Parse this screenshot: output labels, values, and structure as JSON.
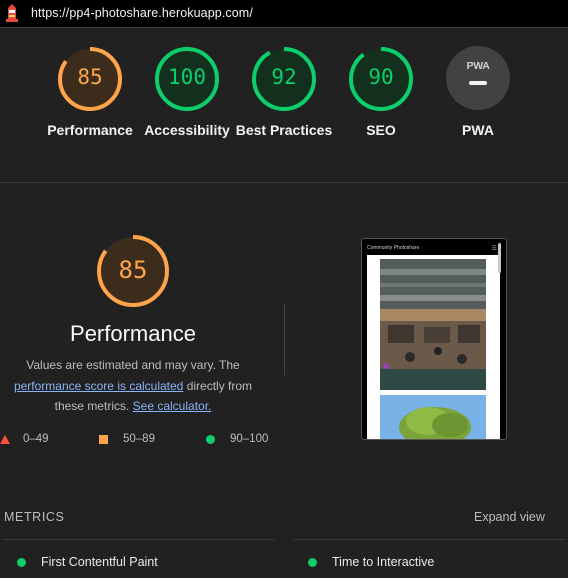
{
  "browser": {
    "url": "https://pp4-photoshare.herokuapp.com/",
    "logo": "lighthouse-icon"
  },
  "colors": {
    "pass": "#0cce6b",
    "average": "#ffa44b",
    "fail": "#ff4e42",
    "link": "#8ab4f8"
  },
  "scores": [
    {
      "label": "Performance",
      "value": "85",
      "score": 85,
      "status": "average"
    },
    {
      "label": "Accessibility",
      "value": "100",
      "score": 100,
      "status": "pass"
    },
    {
      "label": "Best Practices",
      "value": "92",
      "score": 92,
      "status": "pass"
    },
    {
      "label": "SEO",
      "value": "90",
      "score": 90,
      "status": "pass"
    },
    {
      "label": "PWA",
      "badge": "PWA"
    }
  ],
  "performance": {
    "score": "85",
    "score_value": 85,
    "title": "Performance",
    "desc_1": "Values are estimated and may vary. The",
    "link_1": "performance score is calculated",
    "desc_2": " directly from these metrics. ",
    "link_2": "See calculator."
  },
  "legend": [
    {
      "range": "0–49",
      "shape": "triangle"
    },
    {
      "range": "50–89",
      "shape": "square"
    },
    {
      "range": "90–100",
      "shape": "circle"
    }
  ],
  "screenshot": {
    "header": "Community Photoshare",
    "menu": "☰"
  },
  "metrics": {
    "title": "METRICS",
    "expand": "Expand view",
    "items": [
      {
        "label": "First Contentful Paint",
        "status": "pass"
      },
      {
        "label": "Time to Interactive",
        "status": "pass"
      }
    ]
  }
}
